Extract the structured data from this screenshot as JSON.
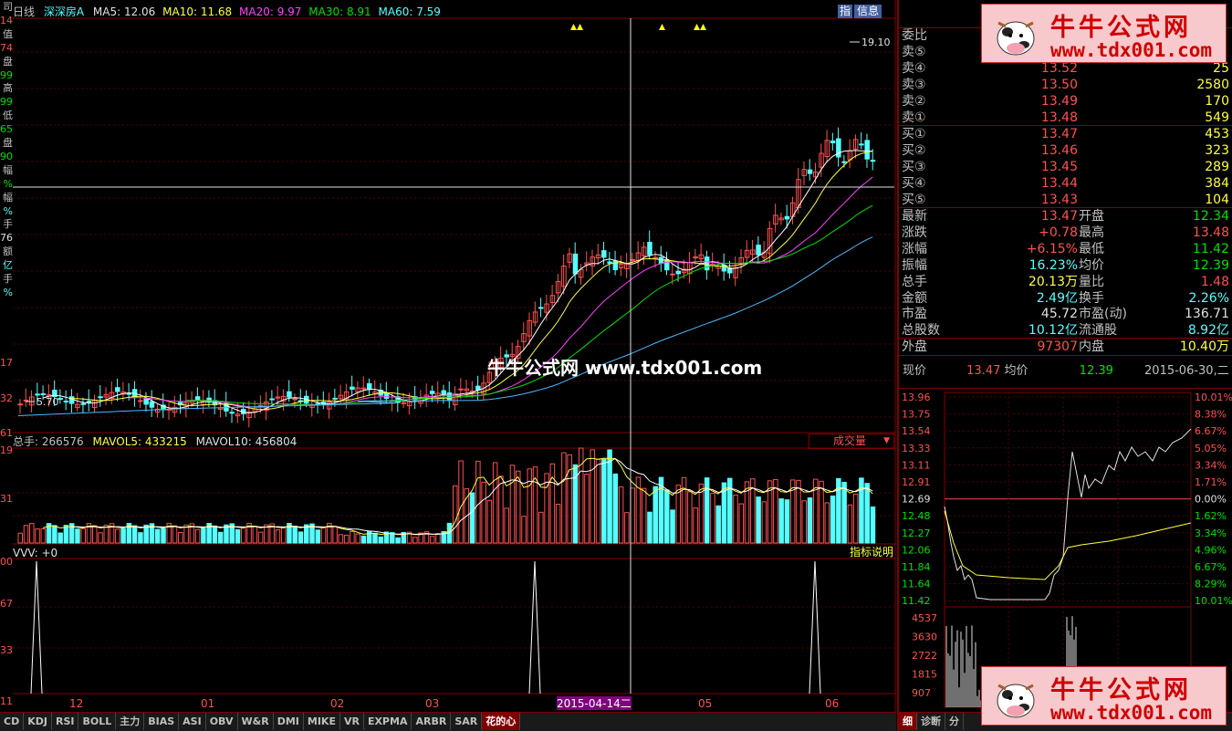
{
  "left_axis": [
    {
      "text": "司",
      "color": "#c0c0c0"
    },
    {
      "text": "14",
      "color": "#ff5050"
    },
    {
      "text": "值",
      "color": "#c0c0c0"
    },
    {
      "text": "74",
      "color": "#ff5050"
    },
    {
      "text": "盘",
      "color": "#c0c0c0"
    },
    {
      "text": "99",
      "color": "#00e000"
    },
    {
      "text": "高",
      "color": "#c0c0c0"
    },
    {
      "text": "99",
      "color": "#00e000"
    },
    {
      "text": "低",
      "color": "#c0c0c0"
    },
    {
      "text": "65",
      "color": "#00e000"
    },
    {
      "text": "盘",
      "color": "#c0c0c0"
    },
    {
      "text": "90",
      "color": "#00e000"
    },
    {
      "text": "幅",
      "color": "#c0c0c0"
    },
    {
      "text": "%",
      "color": "#00e000"
    },
    {
      "text": "幅",
      "color": "#c0c0c0"
    },
    {
      "text": "%",
      "color": "#5ff"
    },
    {
      "text": "手",
      "color": "#c0c0c0"
    },
    {
      "text": "76",
      "color": "#e0e0e0"
    },
    {
      "text": "额",
      "color": "#c0c0c0"
    },
    {
      "text": "亿",
      "color": "#5ff"
    },
    {
      "text": "手",
      "color": "#c0c0c0"
    },
    {
      "text": "%",
      "color": "#5ff"
    }
  ],
  "left_axis_low": [
    {
      "text": "17"
    },
    {
      "text": "32"
    },
    {
      "text": "61"
    },
    {
      "text": "19"
    },
    {
      "text": "31"
    },
    {
      "text": "00"
    },
    {
      "text": "67"
    },
    {
      "text": "33"
    },
    {
      "text": "11"
    }
  ],
  "kline_header": {
    "period": "日线",
    "name": "深深房A",
    "ma5": "MA5: 12.06",
    "ma10": "MA10: 11.68",
    "ma20": "MA20: 9.97",
    "ma30": "MA30: 8.91",
    "ma60": "MA60: 7.59",
    "btn1": "指",
    "btn2": "信息"
  },
  "price_labels": {
    "high": "19.10",
    "low": "5.70"
  },
  "volume_header": {
    "total": "总手: 266576",
    "mavol5": "MAVOL5: 433215",
    "mavol10": "MAVOL10: 456804",
    "dropdown": "成交量"
  },
  "indicator_header": {
    "name": "VVV: +0",
    "help": "指标说明"
  },
  "x_axis": [
    "12",
    "01",
    "02",
    "03",
    "2015-04-14二",
    "05",
    "06"
  ],
  "watermark": "牛牛公式网 www.tdx001.com",
  "tabs": [
    "CD",
    "KDJ",
    "RSI",
    "BOLL",
    "主力",
    "BIAS",
    "ASI",
    "OBV",
    "W&R",
    "DMI",
    "MIKE",
    "VR",
    "EXPMA",
    "ARBR",
    "SAR",
    "花的心"
  ],
  "order_book": {
    "weibi": "委比",
    "asks": [
      {
        "label": "卖⑤",
        "price": "",
        "vol": ""
      },
      {
        "label": "卖④",
        "price": "13.52",
        "vol": "25"
      },
      {
        "label": "卖③",
        "price": "13.50",
        "vol": "2580"
      },
      {
        "label": "卖②",
        "price": "13.49",
        "vol": "170"
      },
      {
        "label": "卖①",
        "price": "13.48",
        "vol": "549"
      }
    ],
    "bids": [
      {
        "label": "买①",
        "price": "13.47",
        "vol": "453"
      },
      {
        "label": "买②",
        "price": "13.46",
        "vol": "323"
      },
      {
        "label": "买③",
        "price": "13.45",
        "vol": "289"
      },
      {
        "label": "买④",
        "price": "13.44",
        "vol": "384"
      },
      {
        "label": "买⑤",
        "price": "13.43",
        "vol": "104"
      }
    ]
  },
  "stats": [
    {
      "l1": "最新",
      "v1": "13.47",
      "c1": "#ff5050",
      "l2": "开盘",
      "v2": "12.34",
      "c2": "#00e000"
    },
    {
      "l1": "涨跌",
      "v1": "+0.78",
      "c1": "#ff5050",
      "l2": "最高",
      "v2": "13.48",
      "c2": "#ff5050"
    },
    {
      "l1": "涨幅",
      "v1": "+6.15%",
      "c1": "#ff5050",
      "l2": "最低",
      "v2": "11.42",
      "c2": "#00e000"
    },
    {
      "l1": "振幅",
      "v1": "16.23%",
      "c1": "#5ff",
      "l2": "均价",
      "v2": "12.39",
      "c2": "#00e000"
    },
    {
      "l1": "总手",
      "v1": "20.13万",
      "c1": "#ffff40",
      "l2": "量比",
      "v2": "1.48",
      "c2": "#ff5050"
    },
    {
      "l1": "金额",
      "v1": "2.49亿",
      "c1": "#5ff",
      "l2": "换手",
      "v2": "2.26%",
      "c2": "#5ff"
    },
    {
      "l1": "市盈",
      "v1": "45.72",
      "c1": "#e0e0e0",
      "l2": "市盈(动)",
      "v2": "136.71",
      "c2": "#e0e0e0"
    },
    {
      "l1": "总股数",
      "v1": "10.12亿",
      "c1": "#5ff",
      "l2": "流通股",
      "v2": "8.92亿",
      "c2": "#5ff"
    },
    {
      "l1": "外盘",
      "v1": "97307",
      "c1": "#ff5050",
      "l2": "内盘",
      "v2": "10.40万",
      "c2": "#ffff40"
    }
  ],
  "intraday": {
    "xianjia_label": "现价",
    "xianjia": "13.47",
    "junjia_label": "均价",
    "junjia": "12.39",
    "date": "2015-06-30,二",
    "price_ticks": [
      "13.96",
      "13.75",
      "13.54",
      "13.33",
      "13.11",
      "12.91",
      "12.69",
      "12.48",
      "12.27",
      "12.06",
      "11.84",
      "11.64",
      "11.42"
    ],
    "pct_ticks": [
      "10.01%",
      "8.38%",
      "6.67%",
      "5.05%",
      "3.34%",
      "1.71%",
      "0.00%",
      "1.62%",
      "3.34%",
      "4.96%",
      "6.67%",
      "8.29%",
      "10.01%"
    ],
    "vol_ticks": [
      "4537",
      "3630",
      "2722",
      "1815",
      "907"
    ],
    "tabs": [
      "细",
      "诊断",
      "分"
    ]
  },
  "logo": {
    "cn": "牛牛公式网",
    "url": "www.tdx001.com"
  },
  "colors": {
    "up": "#ff5050",
    "down": "#5ff",
    "ma5": "#ffffff",
    "ma10": "#ffff40",
    "ma20": "#ff40ff",
    "ma30": "#00e000",
    "ma60": "#4fb8ff",
    "frame": "#800000"
  }
}
